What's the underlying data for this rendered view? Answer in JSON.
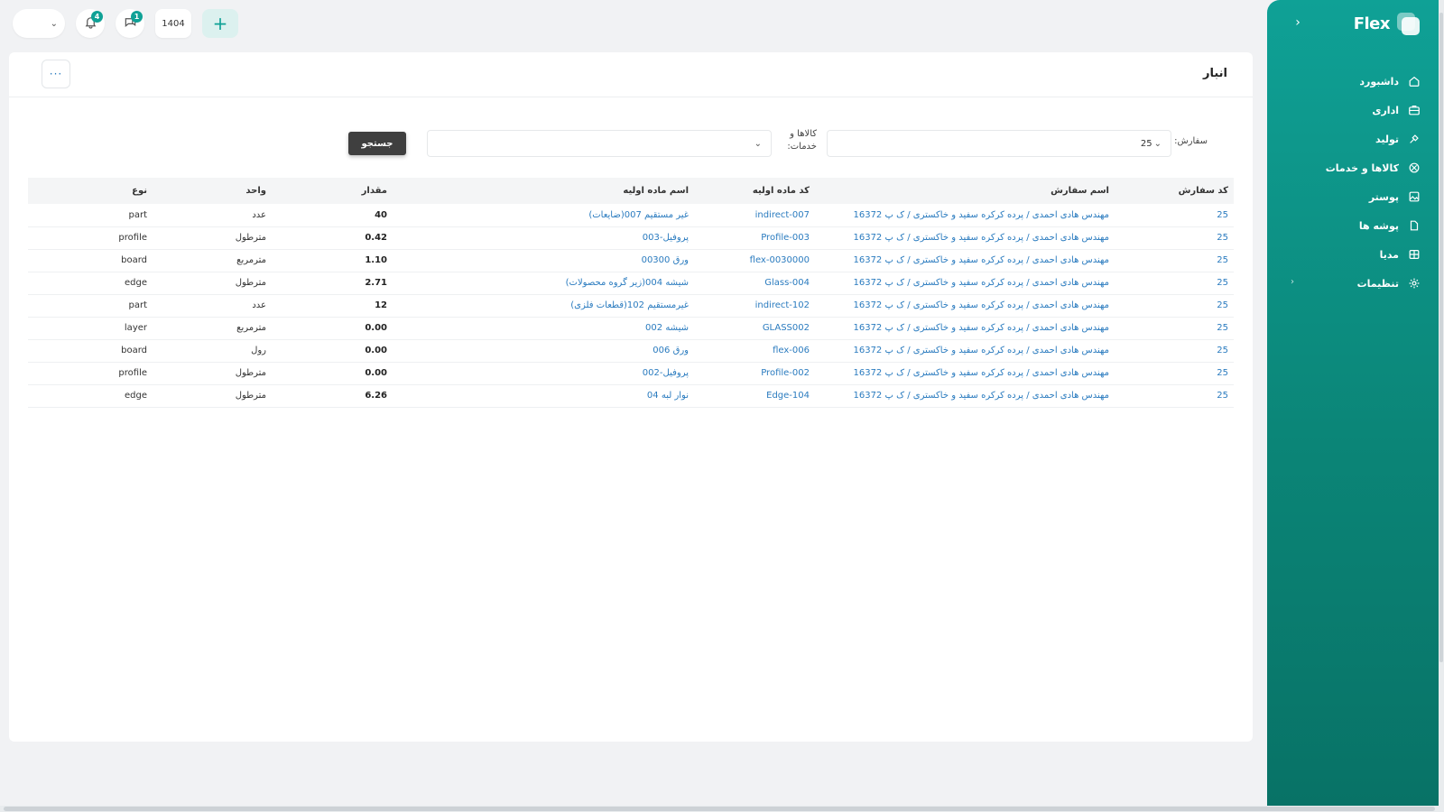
{
  "app": {
    "brand": "Flex",
    "collapse_icon": "chevron-right-icon"
  },
  "sidebar": {
    "items": [
      {
        "label": "داشبورد",
        "icon": "home-icon",
        "has_children": false
      },
      {
        "label": "اداری",
        "icon": "briefcase-icon",
        "has_children": false
      },
      {
        "label": "تولید",
        "icon": "tool-icon",
        "has_children": false
      },
      {
        "label": "کالاها و خدمات",
        "icon": "cube-icon",
        "has_children": false
      },
      {
        "label": "پوستر",
        "icon": "image-icon",
        "has_children": false
      },
      {
        "label": "پوشه ها",
        "icon": "folder-icon",
        "has_children": false
      },
      {
        "label": "مدیا",
        "icon": "media-icon",
        "has_children": false
      },
      {
        "label": "تنظیمات",
        "icon": "gear-icon",
        "has_children": true
      }
    ]
  },
  "topbar": {
    "select_value": "",
    "notifications_badge": "4",
    "messages_badge": "1",
    "year": "1404",
    "add_label": "+"
  },
  "page": {
    "title": "انبار",
    "more_label": "···"
  },
  "filters": {
    "order_label": "سفارش:",
    "order_value": "25",
    "goods_label_line1": "کالاها و",
    "goods_label_line2": "خدمات:",
    "goods_value": "",
    "search_label": "جستجو"
  },
  "table": {
    "headers": [
      "کد سفارش",
      "اسم سفارش",
      "کد ماده اولیه",
      "اسم ماده اولیه",
      "مقدار",
      "واحد",
      "نوع"
    ],
    "rows": [
      [
        "25",
        "مهندس هادی احمدی / پرده کرکره سفید و خاکستری / ک پ 16372",
        "indirect-007",
        "غیر مستقیم 007(ضایعات)",
        "40",
        "عدد",
        "part"
      ],
      [
        "25",
        "مهندس هادی احمدی / پرده کرکره سفید و خاکستری / ک پ 16372",
        "Profile-003",
        "پروفیل-003",
        "0.42",
        "مترطول",
        "profile"
      ],
      [
        "25",
        "مهندس هادی احمدی / پرده کرکره سفید و خاکستری / ک پ 16372",
        "flex-0030000",
        "ورق 00300",
        "1.10",
        "مترمربع",
        "board"
      ],
      [
        "25",
        "مهندس هادی احمدی / پرده کرکره سفید و خاکستری / ک پ 16372",
        "Glass-004",
        "شیشه 004(زیر گروه محصولات)",
        "2.71",
        "مترطول",
        "edge"
      ],
      [
        "25",
        "مهندس هادی احمدی / پرده کرکره سفید و خاکستری / ک پ 16372",
        "indirect-102",
        "غیرمستقیم 102(قطعات فلزی)",
        "12",
        "عدد",
        "part"
      ],
      [
        "25",
        "مهندس هادی احمدی / پرده کرکره سفید و خاکستری / ک پ 16372",
        "GLASS002",
        "شیشه 002",
        "0.00",
        "مترمربع",
        "layer"
      ],
      [
        "25",
        "مهندس هادی احمدی / پرده کرکره سفید و خاکستری / ک پ 16372",
        "flex-006",
        "ورق 006",
        "0.00",
        "رول",
        "board"
      ],
      [
        "25",
        "مهندس هادی احمدی / پرده کرکره سفید و خاکستری / ک پ 16372",
        "Profile-002",
        "پروفیل-002",
        "0.00",
        "مترطول",
        "profile"
      ],
      [
        "25",
        "مهندس هادی احمدی / پرده کرکره سفید و خاکستری / ک پ 16372",
        "Edge-104",
        "نوار لبه 04",
        "6.26",
        "مترطول",
        "edge"
      ]
    ]
  },
  "colors": {
    "accent": "#0fa196",
    "link": "#2a7bbf",
    "button_dark": "#3f3f3f"
  }
}
